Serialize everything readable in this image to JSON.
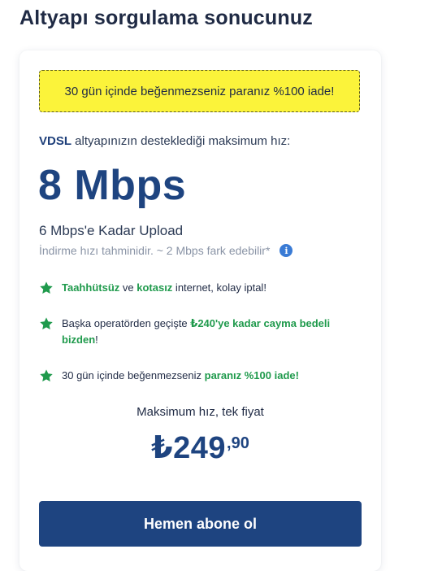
{
  "page": {
    "title": "Altyapı sorgulama sonucunuz"
  },
  "card": {
    "promo_banner": "30 gün içinde beğenmezseniz paranız %100 iade!",
    "infra": {
      "technology": "VDSL",
      "text": " altyapınızın desteklediği maksimum hız:"
    },
    "speed": "8 Mbps",
    "upload": "6 Mbps'e Kadar Upload",
    "estimate_note": "İndirme hızı tahminidir. ~ 2 Mbps fark edebilir*",
    "info_icon": "info-icon",
    "features": [
      {
        "icon": "star-icon",
        "parts": [
          {
            "text": "Taahhütsüz",
            "highlight": true
          },
          {
            "text": " ve ",
            "highlight": false
          },
          {
            "text": "kotasız",
            "highlight": true
          },
          {
            "text": " internet, kolay iptal!",
            "highlight": false
          }
        ]
      },
      {
        "icon": "star-icon",
        "parts": [
          {
            "text": "Başka operatörden geçişte ",
            "highlight": false
          },
          {
            "text": "₺240'ye kadar cayma bedeli bizden",
            "highlight": true
          },
          {
            "text": "!",
            "highlight": false
          }
        ]
      },
      {
        "icon": "star-icon",
        "parts": [
          {
            "text": "30 gün içinde beğenmezseniz ",
            "highlight": false
          },
          {
            "text": "paranız %100 iade!",
            "highlight": true
          }
        ]
      }
    ],
    "price_caption": "Maksimum hız, tek fiyat",
    "price": {
      "main": "₺249",
      "cents": ",90"
    },
    "cta_label": "Hemen abone ol"
  },
  "colors": {
    "brand_blue": "#1e4480",
    "highlight_green": "#1f9a4c",
    "banner_yellow": "#fbf33a",
    "info_blue": "#3a7bd5"
  }
}
